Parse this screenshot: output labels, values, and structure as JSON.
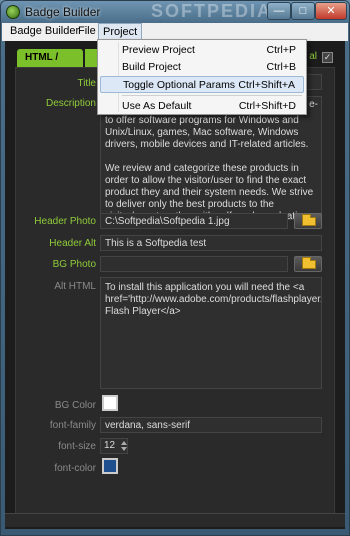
{
  "window": {
    "title": "Badge Builder",
    "watermark": "SOFTPEDIA"
  },
  "menubar": {
    "items": [
      {
        "label": "Badge Builder"
      },
      {
        "label": "File"
      },
      {
        "label": "Project"
      }
    ]
  },
  "project_menu": {
    "items": [
      {
        "label": "Preview Project",
        "shortcut": "Ctrl+P"
      },
      {
        "label": "Build Project",
        "shortcut": "Ctrl+B"
      },
      {
        "label": "Toggle Optional Params",
        "shortcut": "Ctrl+Shift+A"
      },
      {
        "label": "Use As Default",
        "shortcut": "Ctrl+Shift+D"
      }
    ],
    "highlighted_index": 2
  },
  "tabs": {
    "active": "HTML / CSS",
    "optional_label": "al",
    "optional_checked": true
  },
  "form": {
    "title_label": "Title",
    "description_label": "Description",
    "description_value": "We review and categorize these products in order to allow the visitor/user to find the exact product they and their system needs. We strive to deliver only the best products to the visitor/user together with self-made evaluation and review notes.",
    "description_partial_top": "to offer software programs for Windows and Unix/Linux, games, Mac software, Windows drivers, mobile devices and IT-related articles.",
    "description_scroll_hint": "e-",
    "header_photo_label": "Header Photo",
    "header_photo_value": "C:\\Softpedia\\Softpedia 1.jpg",
    "header_alt_label": "Header Alt",
    "header_alt_value": "This is a Softpedia test",
    "bg_photo_label": "BG Photo",
    "bg_photo_value": "",
    "alt_html_label": "Alt HTML",
    "alt_html_value": "To install this application you will need the <a href='http://www.adobe.com/products/flashplayer/'>Adobe Flash Player</a>",
    "bg_color_label": "BG Color",
    "bg_color_value": "#ffffff",
    "font_family_label": "font-family",
    "font_family_value": "verdana, sans-serif",
    "font_size_label": "font-size",
    "font_size_value": "12",
    "font_color_label": "font-color",
    "font_color_value": "#1f4f8f"
  }
}
